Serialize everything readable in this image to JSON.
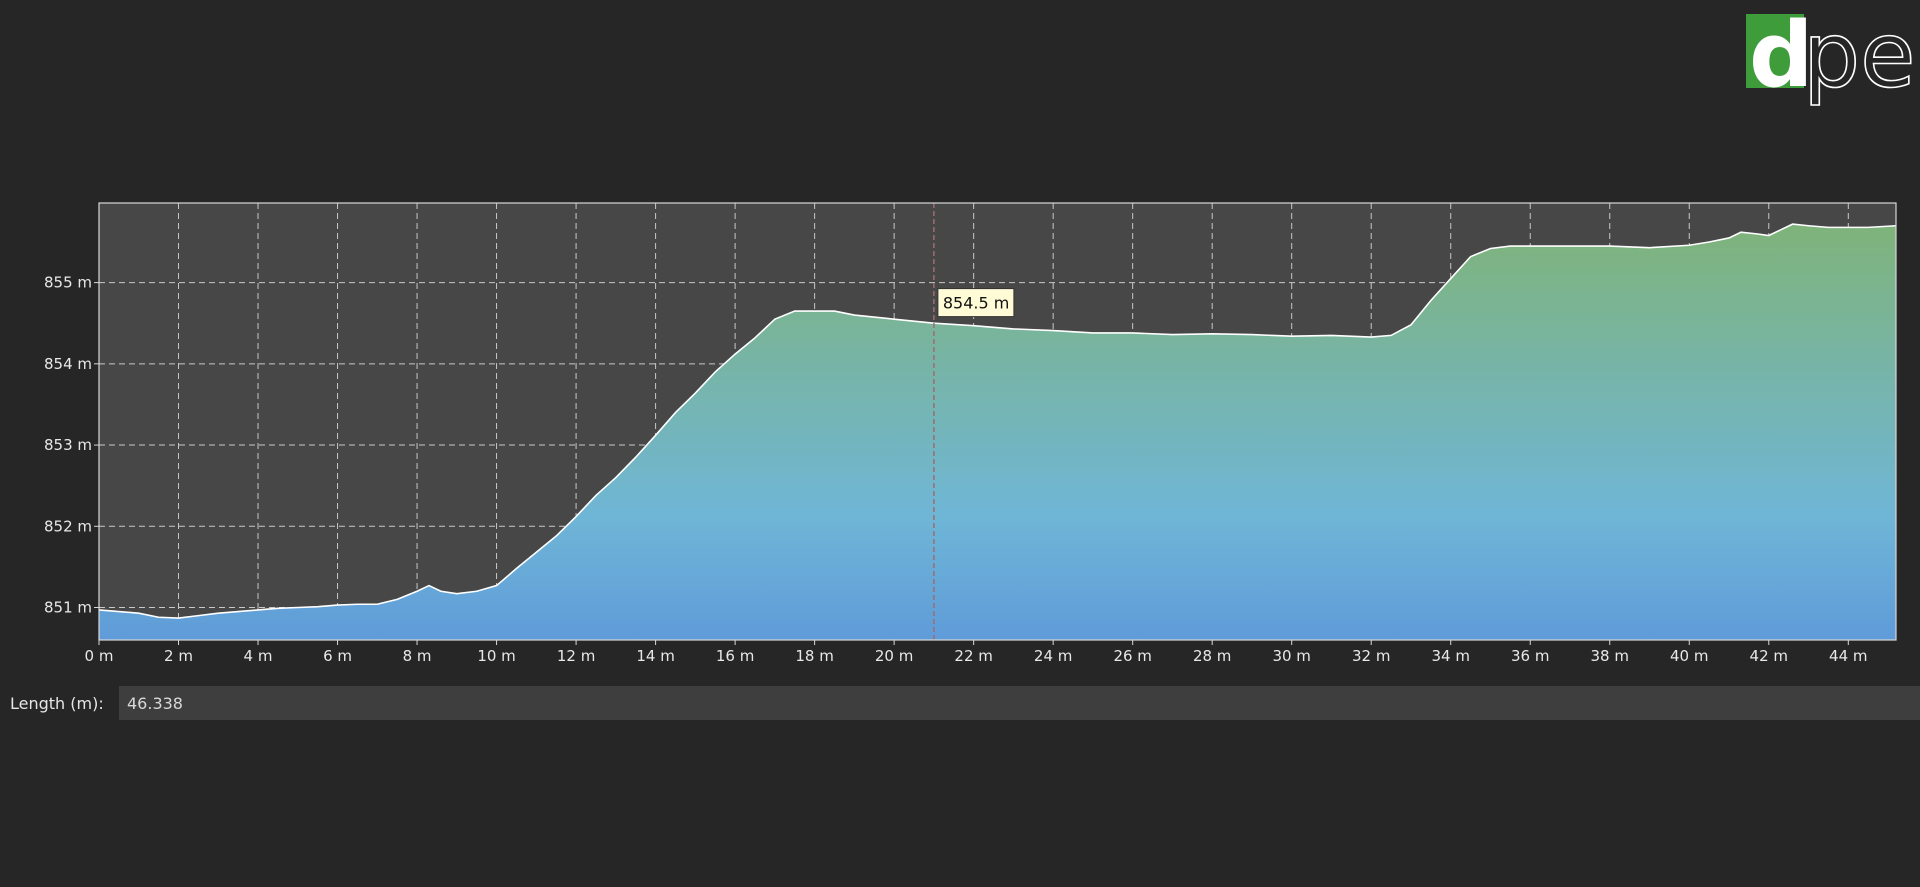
{
  "colors": {
    "background": "#262626",
    "plot_background": "#474747",
    "grid": "#c8c8c8",
    "fill_top": "#7fb37a",
    "fill_mid": "#6fb6d6",
    "fill_bottom": "#5f9bd9",
    "profile_line": "#ffffff",
    "cursor_line": "#9a6f70",
    "tooltip_bg": "#fffbd6",
    "logo_green": "#3f9c3b"
  },
  "logo": {
    "letters": "dpe",
    "icon": "dpe-logo-icon"
  },
  "chart_data": {
    "type": "area",
    "xlabel": "",
    "ylabel": "",
    "xlim": [
      0,
      45.2
    ],
    "ylim": [
      850.6,
      855.98
    ],
    "grid": true,
    "x_ticks": [
      0,
      2,
      4,
      6,
      8,
      10,
      12,
      14,
      16,
      18,
      20,
      22,
      24,
      26,
      28,
      30,
      32,
      34,
      36,
      38,
      40,
      42,
      44
    ],
    "x_tick_labels": [
      "0 m",
      "2 m",
      "4 m",
      "6 m",
      "8 m",
      "10 m",
      "12 m",
      "14 m",
      "16 m",
      "18 m",
      "20 m",
      "22 m",
      "24 m",
      "26 m",
      "28 m",
      "30 m",
      "32 m",
      "34 m",
      "36 m",
      "38 m",
      "40 m",
      "42 m",
      "44 m"
    ],
    "y_ticks": [
      851,
      852,
      853,
      854,
      855
    ],
    "y_tick_labels": [
      "851 m",
      "852 m",
      "853 m",
      "854 m",
      "855 m"
    ],
    "cursor": {
      "x": 21.0,
      "value_label": "854.5 m"
    },
    "series": [
      {
        "x": [
          0,
          0.5,
          1,
          1.5,
          2,
          2.5,
          3,
          3.5,
          4,
          4.5,
          5,
          5.5,
          6,
          6.5,
          7,
          7.5,
          8,
          8.3,
          8.6,
          9,
          9.5,
          10,
          10.5,
          11,
          11.5,
          12,
          12.5,
          13,
          13.5,
          14,
          14.5,
          15,
          15.5,
          16,
          16.5,
          17,
          17.5,
          18,
          18.5,
          19,
          20,
          21,
          22,
          23,
          24,
          25,
          26,
          27,
          28,
          29,
          30,
          31,
          32,
          32.5,
          33,
          33.5,
          34,
          34.5,
          35,
          35.5,
          36,
          37,
          38,
          39,
          40,
          40.5,
          41,
          41.3,
          41.7,
          42,
          42.3,
          42.6,
          43,
          43.5,
          44,
          44.5,
          45.2
        ],
        "y": [
          850.97,
          850.95,
          850.93,
          850.88,
          850.87,
          850.9,
          850.93,
          850.95,
          850.97,
          850.99,
          851.0,
          851.01,
          851.03,
          851.04,
          851.04,
          851.1,
          851.2,
          851.27,
          851.2,
          851.17,
          851.2,
          851.27,
          851.48,
          851.68,
          851.88,
          852.12,
          852.38,
          852.6,
          852.85,
          853.12,
          853.4,
          853.64,
          853.9,
          854.12,
          854.32,
          854.55,
          854.65,
          854.65,
          854.65,
          854.6,
          854.55,
          854.5,
          854.47,
          854.43,
          854.41,
          854.38,
          854.38,
          854.36,
          854.37,
          854.36,
          854.34,
          854.35,
          854.33,
          854.35,
          854.48,
          854.78,
          855.05,
          855.32,
          855.42,
          855.45,
          855.45,
          855.45,
          855.45,
          855.43,
          855.46,
          855.5,
          855.55,
          855.62,
          855.6,
          855.58,
          855.65,
          855.72,
          855.7,
          855.68,
          855.68,
          855.68,
          855.7
        ]
      }
    ]
  },
  "length": {
    "label": "Length (m):",
    "value": "46.338"
  }
}
